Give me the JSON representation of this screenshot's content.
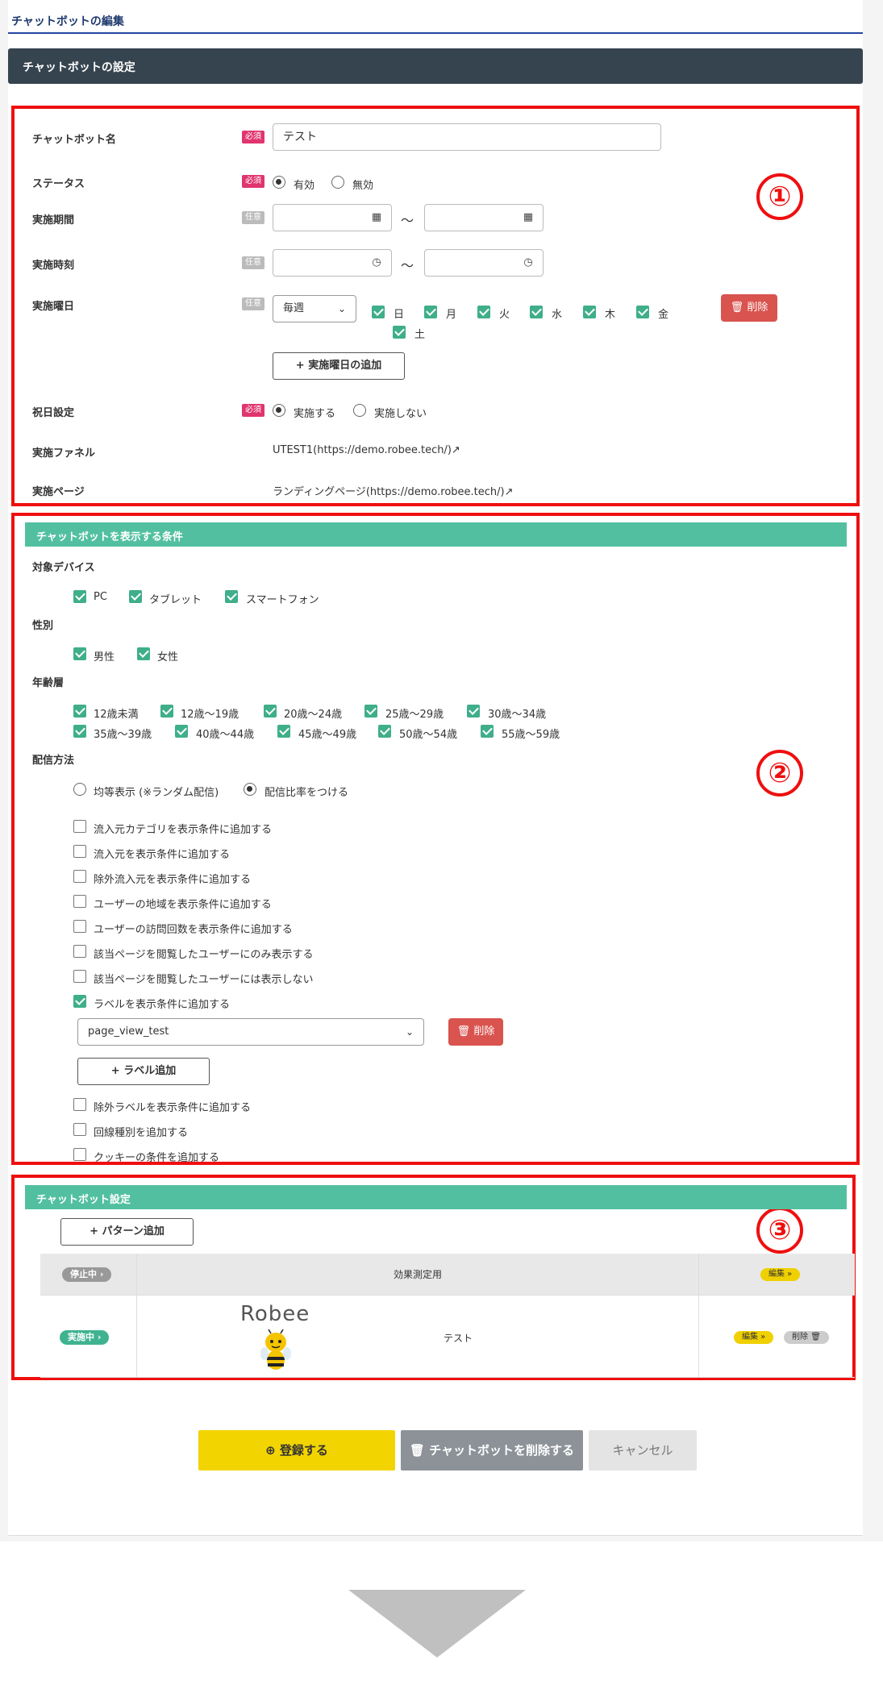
{
  "page": {
    "title": "チャットボットの編集",
    "header": "チャットボットの設定"
  },
  "markers": [
    "①",
    "②",
    "③"
  ],
  "section1": {
    "name_label": "チャットボット名",
    "req": "必須",
    "opt": "任意",
    "name_value": "テスト",
    "status_label": "ステータス",
    "status_on": "有効",
    "status_off": "無効",
    "period_label": "実施期間",
    "time_label": "実施時刻",
    "tilde": "～",
    "weekday_label": "実施曜日",
    "weekday_select": "毎週",
    "days": [
      "日",
      "月",
      "火",
      "水",
      "木",
      "金",
      "土"
    ],
    "delete": "削除",
    "add_weekday": "実施曜日の追加",
    "holiday_label": "祝日設定",
    "holiday_on": "実施する",
    "holiday_off": "実施しない",
    "funnel_label": "実施ファネル",
    "funnel_value": "UTEST1(https://demo.robee.tech/)",
    "page_label": "実施ページ",
    "page_value": "ランディングページ(https://demo.robee.tech/)"
  },
  "section2": {
    "bar": "チャットボットを表示する条件",
    "device_label": "対象デバイス",
    "devices": [
      "PC",
      "タブレット",
      "スマートフォン"
    ],
    "gender_label": "性別",
    "genders": [
      "男性",
      "女性"
    ],
    "age_label": "年齢層",
    "ages1": [
      "12歳未満",
      "12歳～19歳",
      "20歳～24歳",
      "25歳～29歳",
      "30歳～34歳"
    ],
    "ages2": [
      "35歳～39歳",
      "40歳～44歳",
      "45歳～49歳",
      "50歳～54歳",
      "55歳～59歳"
    ],
    "delivery_label": "配信方法",
    "delivery_even": "均等表示 (※ランダム配信)",
    "delivery_ratio": "配信比率をつける",
    "conds": [
      "流入元カテゴリを表示条件に追加する",
      "流入元を表示条件に追加する",
      "除外流入元を表示条件に追加する",
      "ユーザーの地域を表示条件に追加する",
      "ユーザーの訪問回数を表示条件に追加する",
      "該当ページを閲覧したユーザーにのみ表示する",
      "該当ページを閲覧したユーザーには表示しない",
      "ラベルを表示条件に追加する"
    ],
    "label_select": "page_view_test",
    "delete": "削除",
    "add_label": "ラベル追加",
    "conds2": [
      "除外ラベルを表示条件に追加する",
      "回線種別を追加する",
      "クッキーの条件を追加する"
    ]
  },
  "section3": {
    "bar": "チャットボット設定",
    "add_pattern": "パターン追加",
    "row1": {
      "status": "停止中",
      "name": "効果測定用",
      "edit": "編集"
    },
    "row2": {
      "status": "実施中",
      "logo": "Robee",
      "name": "テスト",
      "edit": "編集",
      "delete": "削除"
    }
  },
  "actions": {
    "register": "登録する",
    "delete_bot": "チャットボットを削除する",
    "cancel": "キャンセル"
  }
}
